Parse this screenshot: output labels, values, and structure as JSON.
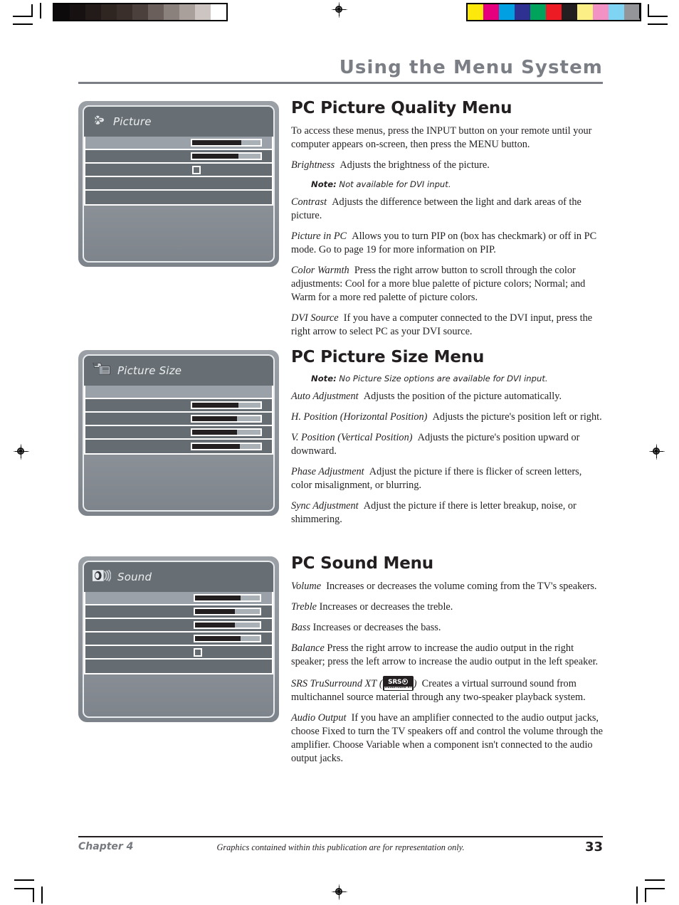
{
  "header": {
    "title": "Using the Menu System"
  },
  "sections": [
    {
      "id": "pc-picture-quality",
      "heading": "PC Picture Quality Menu",
      "blocks": [
        {
          "type": "para",
          "term": "",
          "text": "To access these menus, press the INPUT button on your remote until your computer appears on-screen, then press the MENU button."
        },
        {
          "type": "para",
          "term": "Brightness",
          "text": "Adjusts the brightness of the picture."
        },
        {
          "type": "note",
          "label": "Note:",
          "text": "Not available for DVI input."
        },
        {
          "type": "para",
          "term": "Contrast",
          "text": "Adjusts the difference between the light and dark areas of the picture."
        },
        {
          "type": "para",
          "term": "Picture in PC",
          "text": "Allows you to turn PIP on (box has checkmark) or off in PC mode. Go to page 19 for more information on PIP."
        },
        {
          "type": "para",
          "term": "Color Warmth",
          "text": "Press the right arrow button to scroll through the color adjustments: Cool for a more blue palette of picture colors; Normal; and Warm for a more red palette of picture colors."
        },
        {
          "type": "para",
          "term": "DVI Source",
          "text": "If you have a computer connected to the DVI input, press the right arrow to select PC as your DVI source."
        }
      ]
    },
    {
      "id": "pc-picture-size",
      "heading": "PC Picture Size Menu",
      "blocks": [
        {
          "type": "note",
          "label": "Note:",
          "text": "No Picture Size options are available for DVI input."
        },
        {
          "type": "para",
          "term": "Auto Adjustment",
          "text": "Adjusts the position of the picture automatically."
        },
        {
          "type": "para",
          "term": "H. Position (Horizontal Position)",
          "text": "Adjusts the picture's position left or right."
        },
        {
          "type": "para",
          "term": "V. Position (Vertical Position)",
          "text": "Adjusts the picture's position upward or downward."
        },
        {
          "type": "para",
          "term": "Phase Adjustment",
          "text": "Adjust the picture if there is flicker of screen letters, color misalignment, or blurring."
        },
        {
          "type": "para",
          "term": "Sync Adjustment",
          "text": "Adjust the picture if there is letter breakup, noise, or shimmering."
        }
      ]
    },
    {
      "id": "pc-sound",
      "heading": "PC Sound Menu",
      "blocks": [
        {
          "type": "para",
          "term": "Volume",
          "text": "Increases or decreases the volume coming from the TV's speakers."
        },
        {
          "type": "para",
          "term": "Treble",
          "text": "Increases or decreases the treble."
        },
        {
          "type": "para",
          "term": "Bass",
          "text": "Increases or decreases the bass."
        },
        {
          "type": "para",
          "term": "Balance",
          "text": "Press the right arrow to increase the audio output in the right speaker; press the left arrow to increase the audio output in the left speaker."
        },
        {
          "type": "para-srs",
          "term": "SRS TruSurround XT",
          "badge_top": "SRS",
          "badge_bottom": "TruSurround XT",
          "text": "Creates a virtual surround sound from multichannel source material through any two-speaker playback system."
        },
        {
          "type": "para",
          "term": "Audio Output",
          "text": "If you have an amplifier connected to the audio output jacks, choose Fixed to turn the TV speakers off and control the volume through the amplifier. Choose Variable when a component isn't connected to the audio output jacks."
        }
      ]
    }
  ],
  "osd_menus": [
    {
      "id": "picture",
      "title": "Picture",
      "icon": "flower-icon",
      "rows": [
        {
          "control": "slider",
          "highlight": true,
          "fill_pct": 72
        },
        {
          "control": "slider",
          "highlight": false,
          "fill_pct": 68
        },
        {
          "control": "checkbox",
          "highlight": false,
          "checked": false
        },
        {
          "control": "none",
          "highlight": false
        },
        {
          "control": "none",
          "highlight": false
        }
      ]
    },
    {
      "id": "picture-size",
      "title": "Picture Size",
      "icon": "screens-icon",
      "rows": [
        {
          "control": "none",
          "highlight": true
        },
        {
          "control": "slider",
          "highlight": false,
          "fill_pct": 68
        },
        {
          "control": "slider",
          "highlight": false,
          "fill_pct": 66
        },
        {
          "control": "slider",
          "highlight": false,
          "fill_pct": 66
        },
        {
          "control": "slider",
          "highlight": false,
          "fill_pct": 70
        }
      ]
    },
    {
      "id": "sound",
      "title": "Sound",
      "icon": "speaker-icon",
      "rows": [
        {
          "control": "slider",
          "highlight": true,
          "fill_pct": 70
        },
        {
          "control": "slider",
          "highlight": false,
          "fill_pct": 62
        },
        {
          "control": "slider",
          "highlight": false,
          "fill_pct": 62
        },
        {
          "control": "slider",
          "highlight": false,
          "fill_pct": 70
        },
        {
          "control": "checkbox",
          "highlight": false,
          "checked": false
        },
        {
          "control": "none",
          "highlight": false
        }
      ]
    }
  ],
  "footer": {
    "chapter": "Chapter 4",
    "caption": "Graphics contained within this publication are for representation only.",
    "page_number": "33"
  },
  "calibration": {
    "gray_strip": [
      "#0c0a0a",
      "#171211",
      "#231b19",
      "#2f2622",
      "#3b2f2b",
      "#4b403c",
      "#6a5f5b",
      "#8a807c",
      "#a99f9b",
      "#cdc5c2",
      "#ffffff"
    ],
    "color_strip": [
      "#fde80b",
      "#e6007e",
      "#00a0e3",
      "#2e3192",
      "#00a35c",
      "#ed1c24",
      "#231f20",
      "#fbef86",
      "#f292c4",
      "#7fd4f4",
      "#939598"
    ]
  },
  "colors": {
    "header_gray": "#7b7f85",
    "osd_body": "#656c72",
    "osd_titlebar": "#676e74",
    "osd_highlight": "#9aa1a8",
    "text": "#231f20"
  }
}
